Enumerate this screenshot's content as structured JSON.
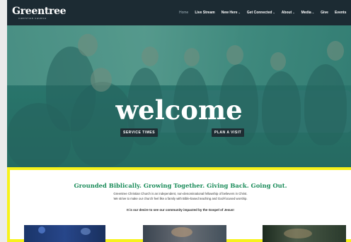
{
  "brand": {
    "name": "Greentree",
    "subtitle": "CHRISTIAN CHURCH"
  },
  "nav": {
    "items": [
      {
        "label": "Home",
        "active": true,
        "dropdown": false
      },
      {
        "label": "Live Stream",
        "active": false,
        "dropdown": false
      },
      {
        "label": "New Here",
        "active": false,
        "dropdown": true
      },
      {
        "label": "Get Connected",
        "active": false,
        "dropdown": true
      },
      {
        "label": "About",
        "active": false,
        "dropdown": true
      },
      {
        "label": "Media",
        "active": false,
        "dropdown": true
      },
      {
        "label": "Give",
        "active": false,
        "dropdown": false
      },
      {
        "label": "Events",
        "active": false,
        "dropdown": false
      }
    ],
    "caret": "⌄"
  },
  "hero": {
    "title": "welcome",
    "service_times_label": "SERVICE TIMES",
    "plan_visit_label": "PLAN A VISIT"
  },
  "intro": {
    "tagline": "Grounded Biblically. Growing Together. Giving Back. Going Out.",
    "description_line1": "Greentree Christian Church is an independent, non-denominational fellowship of believers in Christ.",
    "description_line2": "We strive to make our church feel like a family with Bible-based teaching and God-focused worship.",
    "motto": "It is our desire to see our community impacted by the Gospel of Jesus!"
  },
  "colors": {
    "nav_bg": "#1c2b33",
    "accent_green": "#1b8c5a",
    "highlight_yellow": "#f7f21a",
    "band_green": "#15a06b",
    "band_teal": "#8fb9b7",
    "band_slate": "#4a5a63",
    "band_navy": "#1d2e38"
  }
}
